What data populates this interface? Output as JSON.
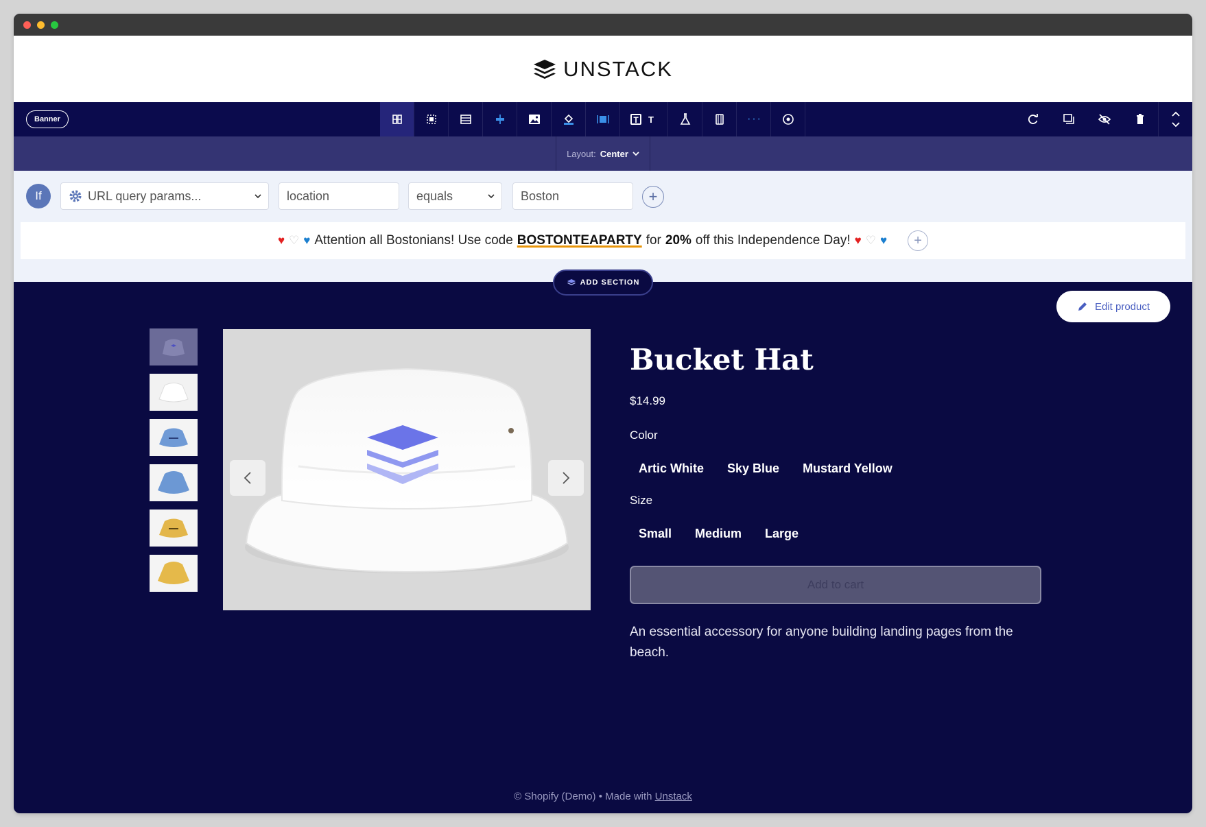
{
  "site": {
    "brand": "UNSTACK"
  },
  "toolbar": {
    "section_label": "Banner",
    "tools": [
      "layout-icon",
      "select-area-icon",
      "section-height-icon",
      "spacing-icon",
      "image-icon",
      "fill-icon",
      "width-icon",
      "text-color-icon",
      "experiment-icon",
      "mobile-icon",
      "custom-code-icon",
      "target-icon"
    ],
    "right_tools": [
      "refresh-icon",
      "duplicate-icon",
      "hide-icon",
      "delete-icon",
      "move-icon"
    ]
  },
  "layout_bar": {
    "label": "Layout:",
    "value": "Center"
  },
  "condition": {
    "if_label": "If",
    "source": "URL query params...",
    "param": "location",
    "operator": "equals",
    "value": "Boston"
  },
  "banner": {
    "text_before": "Attention all Bostonians! Use code",
    "code": "BOSTONTEAPARTY",
    "text_mid": "for",
    "discount": "20%",
    "text_after": "off this Independence Day!"
  },
  "add_section_label": "ADD SECTION",
  "edit_product_label": "Edit product",
  "product": {
    "title": "Bucket Hat",
    "price": "$14.99",
    "color_label": "Color",
    "colors": [
      "Artic White",
      "Sky Blue",
      "Mustard Yellow"
    ],
    "size_label": "Size",
    "sizes": [
      "Small",
      "Medium",
      "Large"
    ],
    "add_to_cart": "Add to cart",
    "description": "An essential accessory for anyone building landing pages from the beach."
  },
  "footer": {
    "text": "© Shopify (Demo) • Made with",
    "link": "Unstack"
  },
  "colors": {
    "page_bg": "#0a0a42",
    "toolbar_bg": "#0b0b4d",
    "accent": "#4a5fc1"
  }
}
